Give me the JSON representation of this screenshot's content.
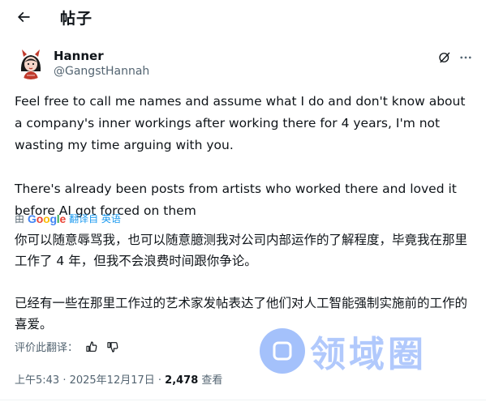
{
  "header": {
    "title": "帖子",
    "back_icon": "arrow-left-icon"
  },
  "author": {
    "name": "Hanner",
    "handle": "@GangstHannah",
    "avatar_icon": "avatar-devil-girl"
  },
  "actions": {
    "grok_icon": "grok-icon",
    "more_icon": "more-horizontal-icon"
  },
  "tweet": {
    "text": "Feel free to call me names and assume what I do and don't know about a company's inner workings after working there for 4 years, I'm not wasting my time arguing with you.\n\nThere's already been posts from artists who worked there and loved it before AI got forced on them"
  },
  "translation": {
    "by_prefix": "由",
    "provider": "Google",
    "link_label": "翻译自 英语",
    "text": "你可以随意辱骂我，也可以随意臆测我对公司内部运作的了解程度，毕竟我在那里工作了 4 年，但我不会浪费时间跟你争论。\n\n已经有一些在那里工作过的艺术家发帖表达了他们对人工智能强制实施前的工作的喜爱。",
    "rate_label": "评价此翻译："
  },
  "meta": {
    "time": "上午5:43 · 2025年12月17日 · ",
    "views_count": "2,478",
    "views_label": " 查看"
  },
  "watermark": {
    "text": "领域圈"
  },
  "colors": {
    "link": "#1d9bf0",
    "secondary": "#536471",
    "text": "#0f1419"
  }
}
